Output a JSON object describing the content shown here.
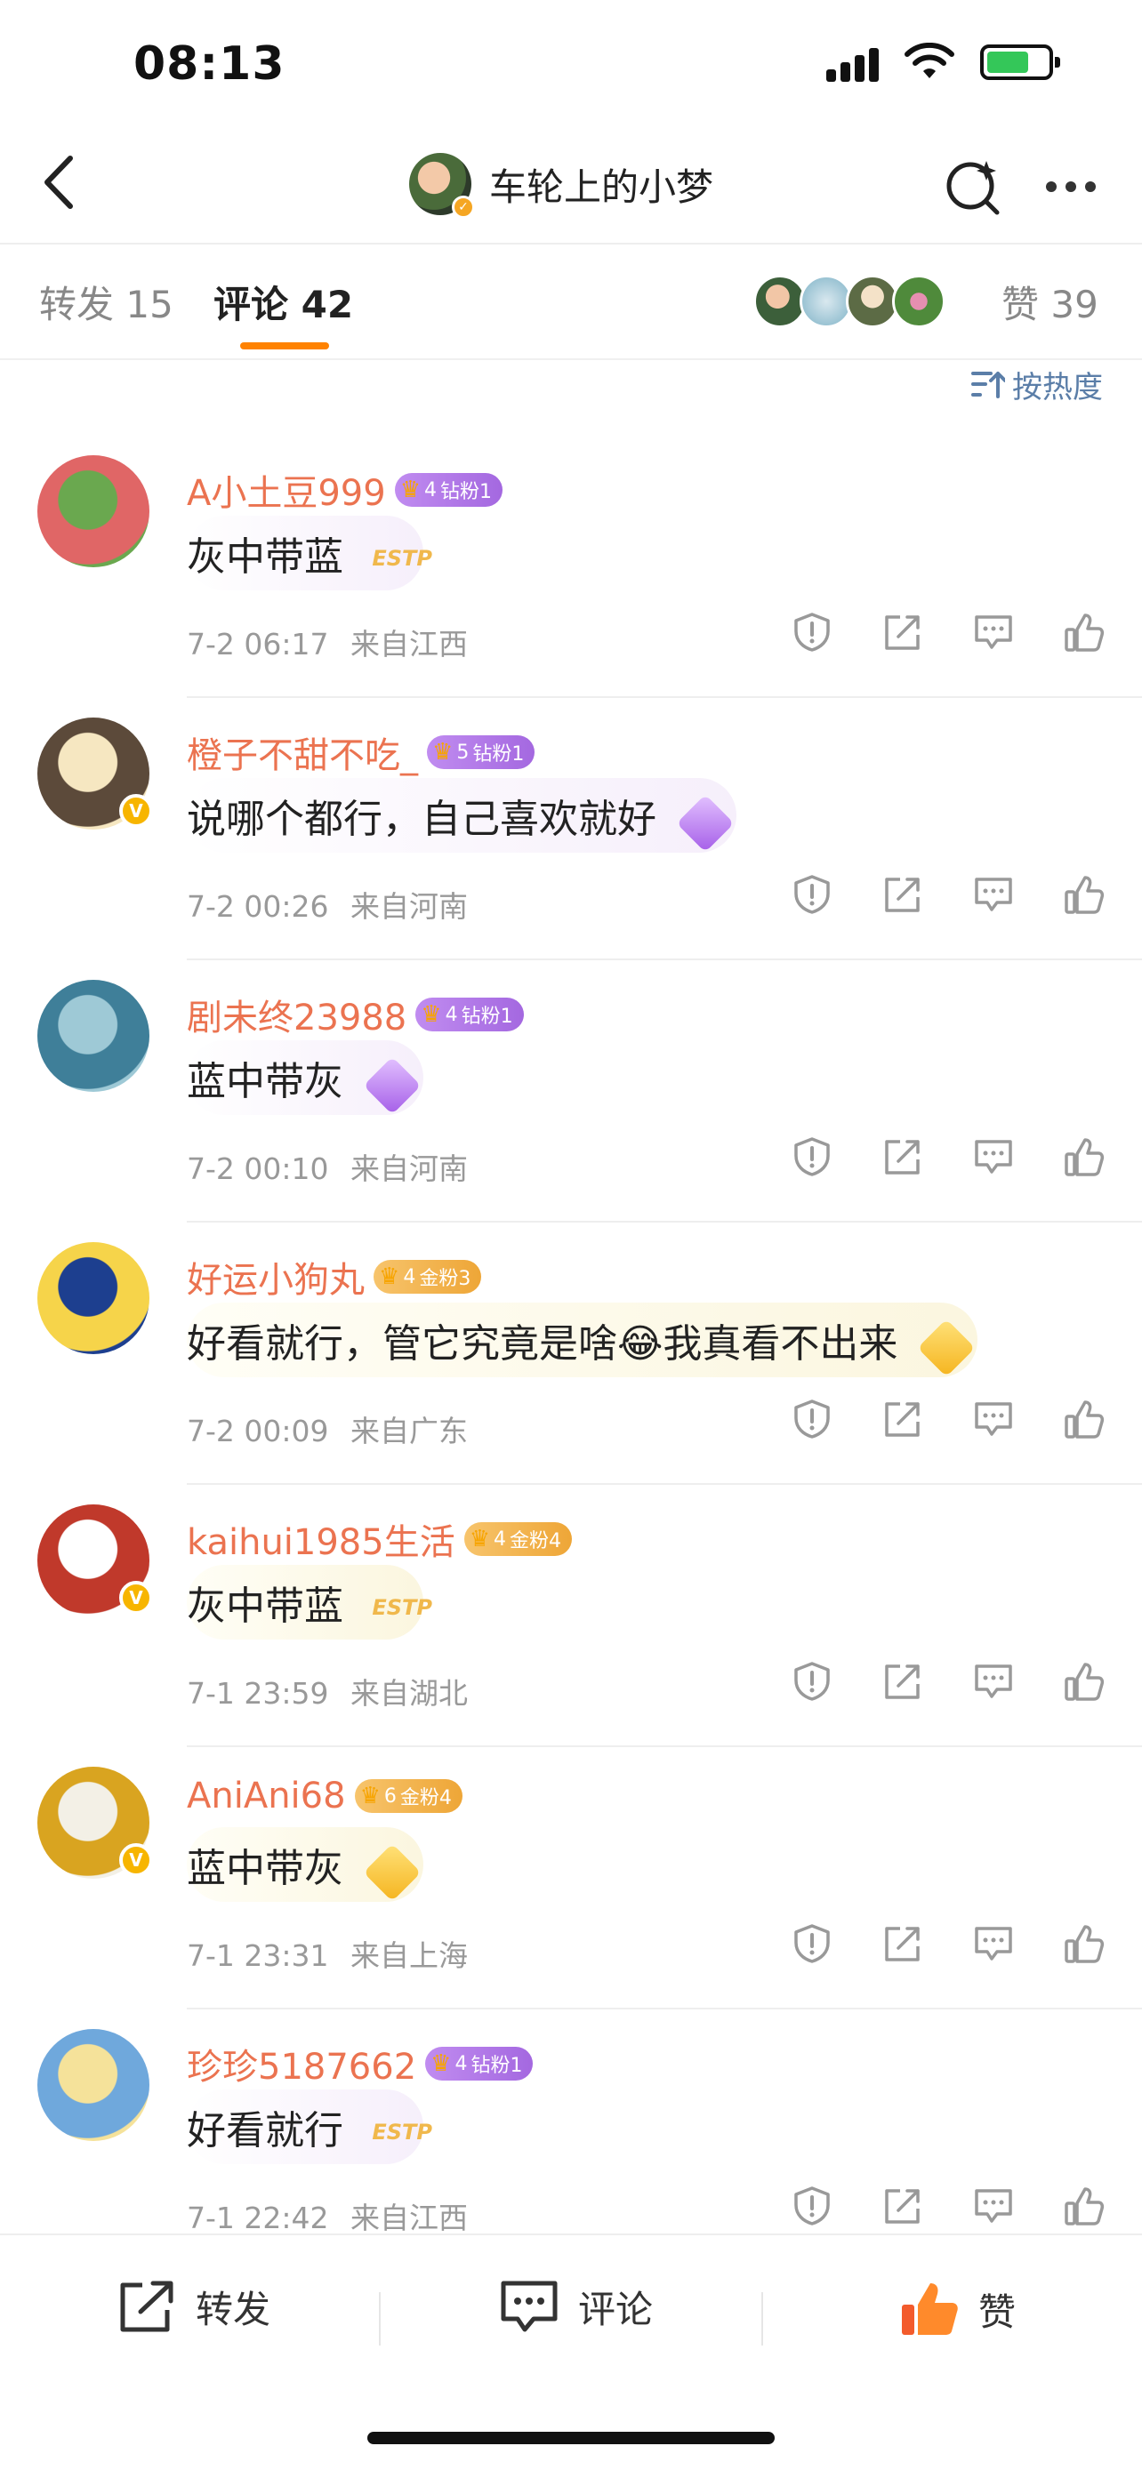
{
  "status_bar": {
    "time": "08:13"
  },
  "nav": {
    "title": "车轮上的小梦"
  },
  "tabs": {
    "repost_label": "转发",
    "repost_count": "15",
    "comment_label": "评论",
    "comment_count": "42",
    "like_label": "赞",
    "like_count": "39"
  },
  "sort": {
    "label": "按热度"
  },
  "comments": [
    {
      "name": "A小土豆999",
      "badge_level": "4",
      "badge_text": "钻粉1",
      "badge_type": "diamond",
      "text": "灰中带蓝",
      "bubble": "ESTP",
      "date": "7-2 06:17",
      "location": "来自江西",
      "verified": false,
      "avatar_colors": [
        "#6aa84f",
        "#e06666"
      ]
    },
    {
      "name": "橙子不甜不吃_",
      "badge_level": "5",
      "badge_text": "钻粉1",
      "badge_type": "diamond",
      "text": "说哪个都行，自己喜欢就好",
      "bubble": "",
      "date": "7-2 00:26",
      "location": "来自河南",
      "verified": true,
      "avatar_colors": [
        "#f6e7c1",
        "#5c4a3a"
      ]
    },
    {
      "name": "剧未终23988",
      "badge_level": "4",
      "badge_text": "钻粉1",
      "badge_type": "diamond",
      "text": "蓝中带灰",
      "bubble": "",
      "date": "7-2 00:10",
      "location": "来自河南",
      "verified": false,
      "avatar_colors": [
        "#9ec9d6",
        "#3f7f99"
      ]
    },
    {
      "name": "好运小狗丸",
      "badge_level": "4",
      "badge_text": "金粉3",
      "badge_type": "gold",
      "text": "好看就行，管它究竟是啥😂我真看不出来",
      "bubble": "",
      "date": "7-2 00:09",
      "location": "来自广东",
      "verified": false,
      "avatar_colors": [
        "#1d3f8f",
        "#f6d44a"
      ]
    },
    {
      "name": "kaihui1985生活",
      "badge_level": "4",
      "badge_text": "金粉4",
      "badge_type": "gold",
      "text": "灰中带蓝",
      "bubble": "ESTP",
      "date": "7-1 23:59",
      "location": "来自湖北",
      "verified": true,
      "avatar_colors": [
        "#ffffff",
        "#c0392b"
      ]
    },
    {
      "name": "AniAni68",
      "badge_level": "6",
      "badge_text": "金粉4",
      "badge_type": "gold",
      "text": "蓝中带灰",
      "bubble": "",
      "date": "7-1 23:31",
      "location": "来自上海",
      "verified": true,
      "avatar_colors": [
        "#f3f0e6",
        "#d9a420"
      ]
    },
    {
      "name": "珍珍5187662",
      "badge_level": "4",
      "badge_text": "钻粉1",
      "badge_type": "diamond",
      "text": "好看就行",
      "bubble": "ESTP",
      "date": "7-1 22:42",
      "location": "来自江西",
      "verified": false,
      "avatar_colors": [
        "#f5e29a",
        "#6fa8dc"
      ]
    }
  ],
  "bottom_bar": {
    "repost": "转发",
    "comment": "评论",
    "like": "赞"
  },
  "colors": {
    "accent": "#ff8200",
    "username": "#eb7350",
    "link": "#5b7ea8"
  }
}
